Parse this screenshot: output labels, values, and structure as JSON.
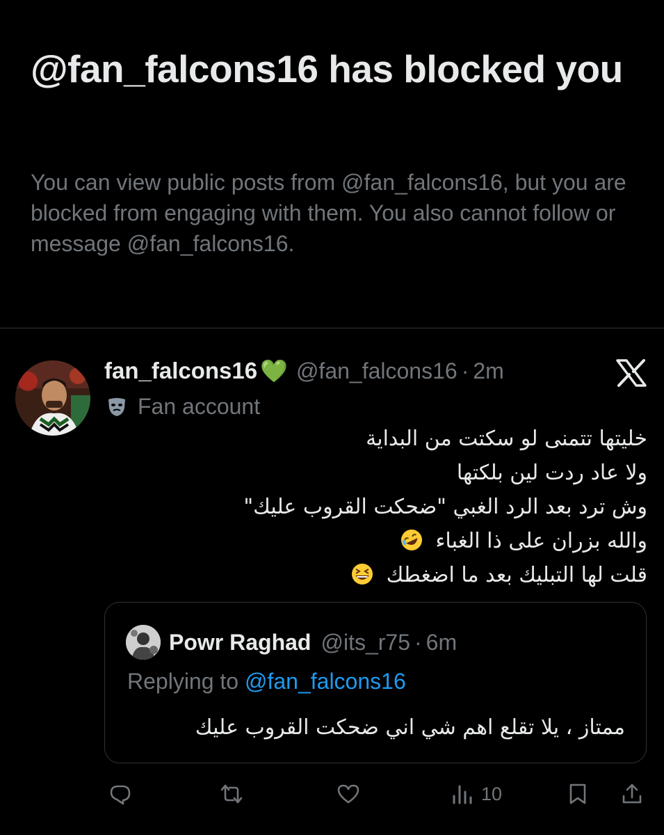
{
  "block_notice": {
    "title": "@fan_falcons16 has blocked you",
    "description": "You can view public posts from @fan_falcons16, but you are blocked from engaging with them. You also cannot follow or message @fan_falcons16."
  },
  "post": {
    "display_name": "fan_falcons16",
    "name_emoji": "💚",
    "handle": "@fan_falcons16",
    "separator": "·",
    "time": "2m",
    "account_label": "Fan account",
    "text_lines": [
      "خليتها تتمنى لو سكتت من البداية",
      "ولا عاد ردت لين بلكتها",
      "وش ترد بعد الرد الغبي \"ضحكت القروب عليك\"",
      "والله بزران على ذا الغباء",
      "قلت لها التبليك بعد ما اضغطك"
    ],
    "line_emojis": [
      "rolling-laughing-emoji",
      "grinning-squinting-emoji"
    ]
  },
  "quoted_post": {
    "display_name": "Powr Raghad",
    "handle": "@its_r75",
    "separator": "·",
    "time": "6m",
    "replying_prefix": "Replying to ",
    "replying_to": "@fan_falcons16",
    "text": "ممتاز ، يلا تقلع اهم شي اني ضحكت القروب عليك"
  },
  "actions": {
    "views": "10",
    "icons": [
      "reply-icon",
      "repost-icon",
      "like-icon",
      "views-icon",
      "bookmark-icon",
      "share-icon"
    ]
  },
  "colors": {
    "background": "#000000",
    "text": "#e7e9ea",
    "muted": "#71767b",
    "link": "#1d9bf0",
    "border": "#2f3336"
  }
}
